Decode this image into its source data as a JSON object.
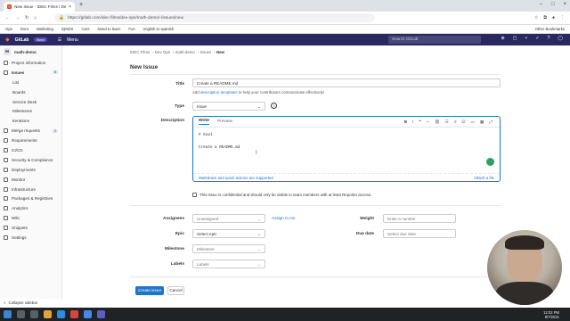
{
  "browser": {
    "tab_title": "New Issue · IDEC Films / Dev Op",
    "url": "https://gitlab.com/idec-films/dev-ops/math-demo/-/issues/new",
    "bookmarks": [
      "Ops",
      "Dom",
      "Marketing",
      "IQNDX",
      "Cars",
      "Need to learn",
      "Fun",
      "english to spanish"
    ],
    "other_bookmarks": "Other Bookmarks"
  },
  "gitlab": {
    "logo": "GitLab",
    "next_badge": "Next",
    "menu": "Menu",
    "search_placeholder": "Search GitLab"
  },
  "sidebar": {
    "project_letter": "M",
    "project": "math-demo",
    "items": [
      {
        "label": "Project information",
        "icon": "info-icon",
        "indent": false
      },
      {
        "label": "Issues",
        "icon": "issues-icon",
        "indent": false,
        "count": "0",
        "active": true
      },
      {
        "label": "List",
        "indent": true
      },
      {
        "label": "Boards",
        "indent": true
      },
      {
        "label": "Service Desk",
        "indent": true
      },
      {
        "label": "Milestones",
        "indent": true
      },
      {
        "label": "Iterations",
        "indent": true
      },
      {
        "label": "Merge requests",
        "icon": "merge-request-icon",
        "count": "0"
      },
      {
        "label": "Requirements",
        "icon": "requirements-icon"
      },
      {
        "label": "CI/CD",
        "icon": "rocket-icon"
      },
      {
        "label": "Security & Compliance",
        "icon": "shield-icon"
      },
      {
        "label": "Deployments",
        "icon": "deploy-icon"
      },
      {
        "label": "Monitor",
        "icon": "monitor-icon"
      },
      {
        "label": "Infrastructure",
        "icon": "cloud-icon"
      },
      {
        "label": "Packages & Registries",
        "icon": "package-icon"
      },
      {
        "label": "Analytics",
        "icon": "chart-icon"
      },
      {
        "label": "Wiki",
        "icon": "book-icon"
      },
      {
        "label": "Snippets",
        "icon": "snippet-icon"
      },
      {
        "label": "Settings",
        "icon": "gear-icon"
      }
    ],
    "collapse": "Collapse sidebar"
  },
  "breadcrumb": [
    "IDEC Films",
    "Dev Ops",
    "math-demo",
    "Issues",
    "New"
  ],
  "page_title": "New Issue",
  "form": {
    "title_label": "Title",
    "title_value": "Create a README.md",
    "template_note_prefix": "Add ",
    "template_note_link": "description templates",
    "template_note_suffix": " to help your contributors communicate effectively!",
    "type_label": "Type",
    "type_value": "Issue",
    "description_label": "Description",
    "tab_write": "Write",
    "tab_preview": "Preview",
    "description_text": "# Goal\n\nCreate a README.md",
    "markdown_note": "Markdown and quick actions are supported",
    "attach": "Attach a file",
    "confidential": "This issue is confidential and should only be visible to team members with at least Reporter access.",
    "assignees_label": "Assignees",
    "assignees_value": "Unassigned",
    "assign_to_me": "Assign to me",
    "weight_label": "Weight",
    "weight_placeholder": "Enter a number",
    "epic_label": "Epic",
    "epic_value": "Select epic",
    "due_label": "Due date",
    "due_placeholder": "Select due date",
    "milestone_label": "Milestone",
    "milestone_value": "Milestone",
    "labels_label": "Labels",
    "labels_value": "Labels",
    "create_button": "Create issue",
    "cancel_button": "Cancel"
  },
  "taskbar": {
    "time": "12:02 PM",
    "date": "8/7/2021"
  }
}
